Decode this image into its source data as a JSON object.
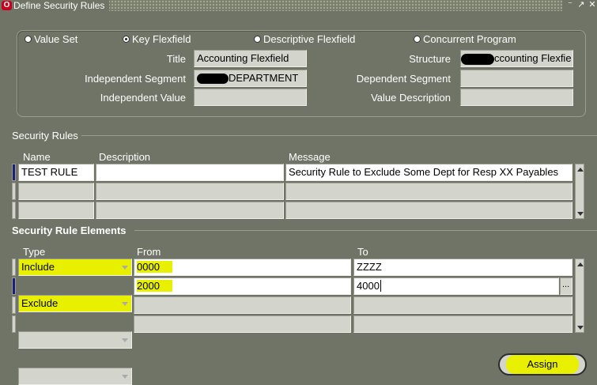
{
  "window": {
    "title": "Define Security Rules",
    "controls": [
      "⁻",
      "↗",
      "✕"
    ]
  },
  "flex_type": {
    "options": [
      "Value Set",
      "Key Flexfield",
      "Descriptive Flexfield",
      "Concurrent Program"
    ],
    "selected": "Key Flexfield"
  },
  "header": {
    "title_label": "Title",
    "title_value": "Accounting Flexfield",
    "structure_label": "Structure",
    "structure_value": "ccounting Flexfie",
    "indep_segment_label": "Independent Segment",
    "indep_segment_value": "DEPARTMENT",
    "dep_segment_label": "Dependent Segment",
    "dep_segment_value": "",
    "indep_value_label": "Independent Value",
    "indep_value_value": "",
    "value_desc_label": "Value Description",
    "value_desc_value": ""
  },
  "security_rules": {
    "section_title": "Security Rules",
    "columns": {
      "name": "Name",
      "description": "Description",
      "message": "Message"
    },
    "rows": [
      {
        "name": "TEST RULE",
        "description": "",
        "message": "Security Rule to Exclude Some Dept for Resp XX Payables"
      },
      {
        "name": "",
        "description": "",
        "message": ""
      },
      {
        "name": "",
        "description": "",
        "message": ""
      }
    ]
  },
  "elements": {
    "section_title": "Security Rule Elements",
    "columns": {
      "type": "Type",
      "from": "From",
      "to": "To"
    },
    "rows": [
      {
        "type": "Include",
        "from": "0000",
        "to": "ZZZZ"
      },
      {
        "type": "Exclude",
        "from": "2000",
        "to": "4000"
      },
      {
        "type": "",
        "from": "",
        "to": ""
      },
      {
        "type": "",
        "from": "",
        "to": ""
      }
    ],
    "lov_button": "..."
  },
  "assign_button": "Assign",
  "colors": {
    "highlight": "#e8f000",
    "background": "#6f7466",
    "field": "#d3d5cc",
    "current_record": "#1a1f7a"
  }
}
